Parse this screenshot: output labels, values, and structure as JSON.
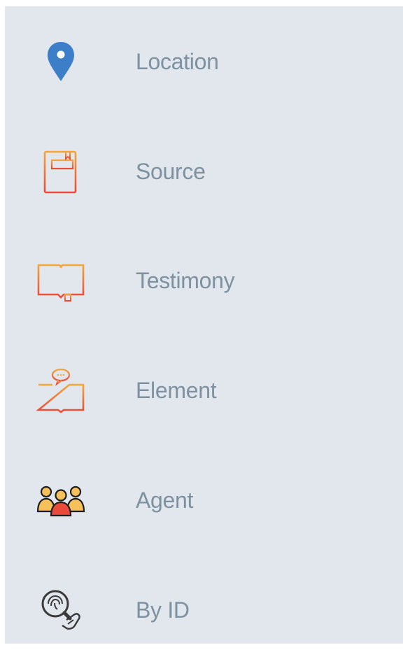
{
  "menu": {
    "items": [
      {
        "label": "Location",
        "icon": "location-pin-icon"
      },
      {
        "label": "Source",
        "icon": "book-icon"
      },
      {
        "label": "Testimony",
        "icon": "open-book-icon"
      },
      {
        "label": "Element",
        "icon": "book-speech-bubble-icon"
      },
      {
        "label": "Agent",
        "icon": "people-group-icon"
      },
      {
        "label": "By ID",
        "icon": "search-fingerprint-icon"
      }
    ]
  },
  "colors": {
    "panel_background": "#e1e7ec",
    "label_text": "#7d91a1",
    "pin_blue": "#3d7ec9",
    "icon_orange": "#f5a63a",
    "icon_red": "#ea4a3a",
    "agent_skin": "#f6c15a",
    "agent_dark": "#1e1e1e",
    "search_gray": "#3a3a3a"
  }
}
